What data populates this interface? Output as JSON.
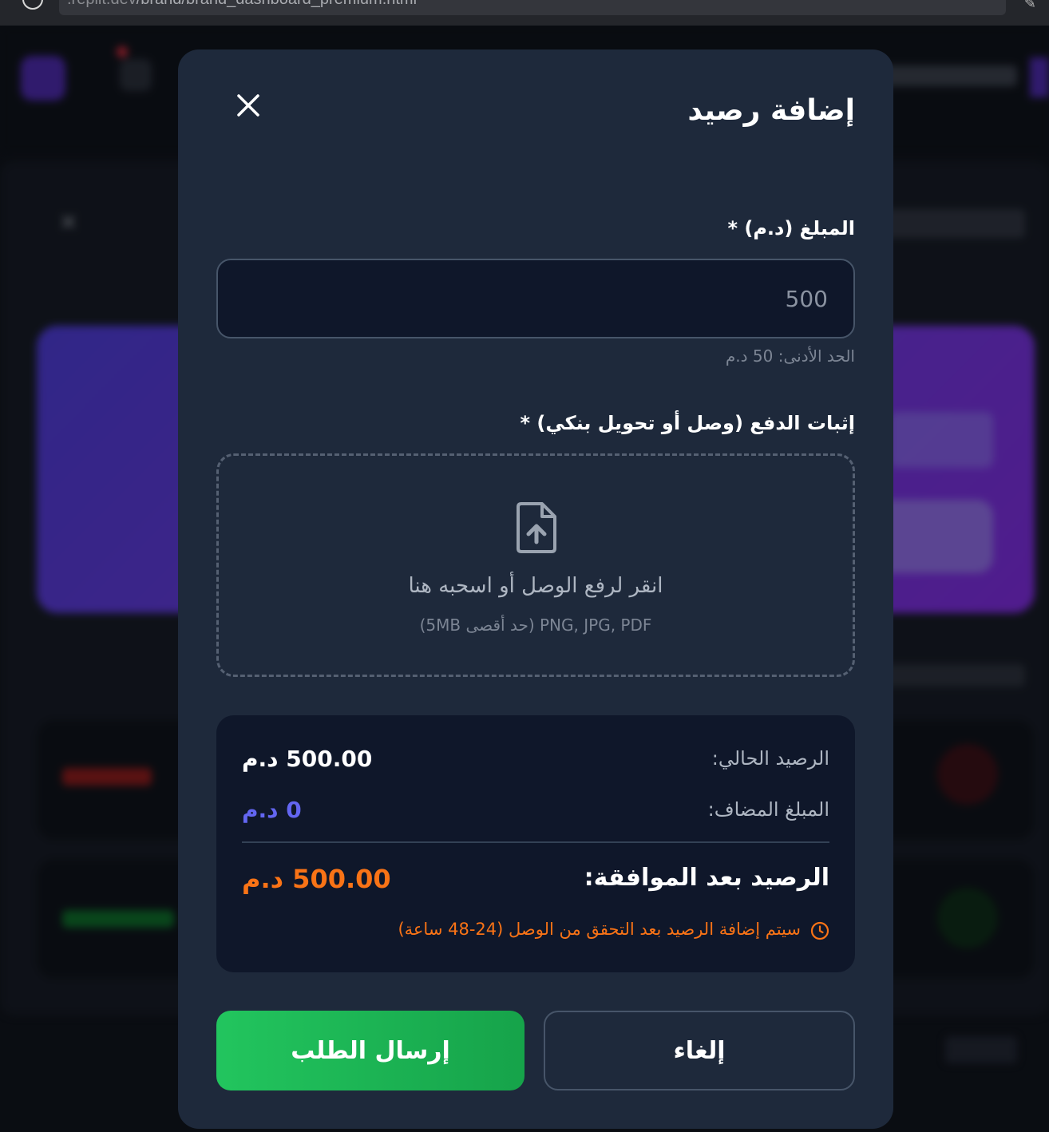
{
  "browser": {
    "url_host": ".replit.dev",
    "url_path": "/brand/brand_dashboard_premium.html"
  },
  "modal": {
    "title": "إضافة رصيد",
    "close_icon": "close-icon",
    "amount": {
      "label": "المبلغ (د.م) *",
      "placeholder": "500",
      "value": "",
      "hint": "الحد الأدنى: 50 د.م"
    },
    "proof": {
      "label": "إثبات الدفع (وصل أو تحويل بنكي) *",
      "icon": "file-upload-icon",
      "main_text": "انقر لرفع الوصل أو اسحبه هنا",
      "sub_text": "PNG, JPG, PDF (حد أقصى 5MB)"
    },
    "summary": {
      "current_label": "الرصيد الحالي:",
      "current_value": "500.00 د.م",
      "added_label": "المبلغ المضاف:",
      "added_value": "0 د.م",
      "after_label": "الرصيد بعد الموافقة:",
      "after_value": "500.00 د.م",
      "note": "سيتم إضافة الرصيد بعد التحقق من الوصل (24-48 ساعة)",
      "note_icon": "clock-icon"
    },
    "buttons": {
      "cancel": "إلغاء",
      "submit": "إرسال الطلب"
    }
  },
  "colors": {
    "modal_bg": "#1e293b",
    "panel_bg": "#0f172a",
    "accent_blue": "#6366f1",
    "accent_orange": "#f97316",
    "accent_green": "#22c55e"
  }
}
